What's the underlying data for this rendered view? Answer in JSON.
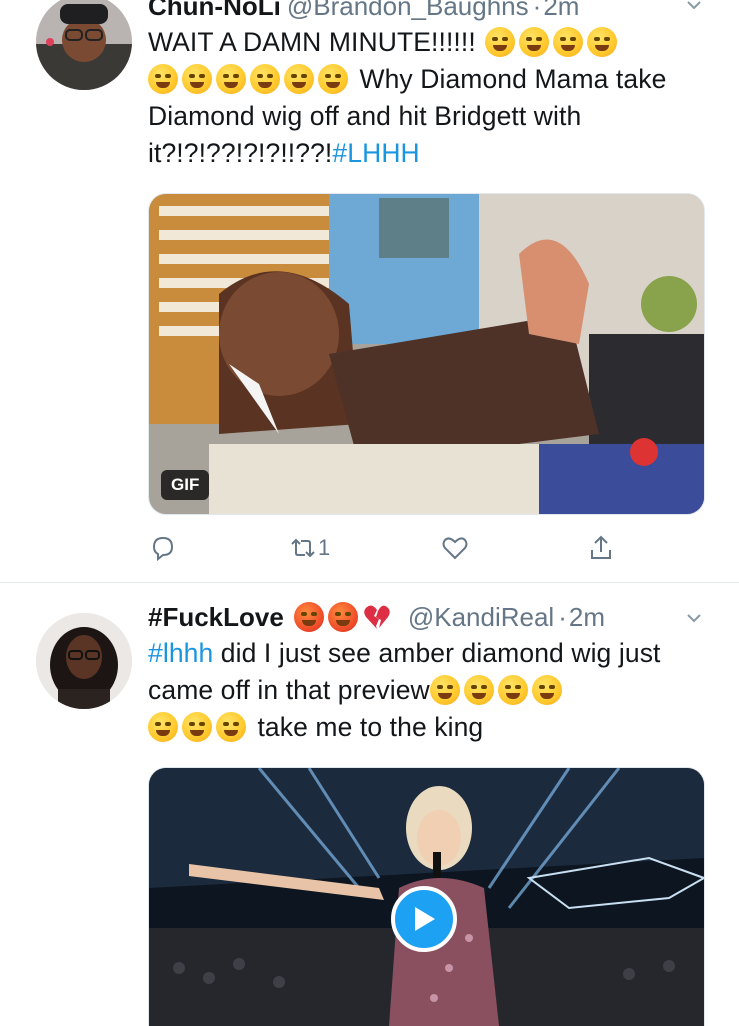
{
  "tweets": [
    {
      "display_name": "Chun-NoLi",
      "handle": "@Brandon_Baughns",
      "separator": "·",
      "time": "2m",
      "text_before": "WAIT A DAMN MINUTE!!!!!! ",
      "text_middle": " Why Diamond Mama take Diamond wig off and hit Bridgett with it?!?!??!?!?!!??!",
      "hashtag": "#LHHH",
      "media_badge": "GIF",
      "retweet_count": "1",
      "icons": [
        "reply-icon",
        "retweet-icon",
        "like-icon",
        "share-icon"
      ]
    },
    {
      "display_name": "#FuckLove",
      "handle": "@KandiReal",
      "separator": "·",
      "time": "2m",
      "hashtag": "#lhhh",
      "text_line1": " did I just see amber diamond wig just came off in that preview",
      "text_end": " take me to the king",
      "media_control": "play-icon"
    }
  ],
  "colors": {
    "link": "#1b95e0",
    "secondary_text": "#657786",
    "divider": "#e6ecf0",
    "play_button": "#1da1f2"
  }
}
